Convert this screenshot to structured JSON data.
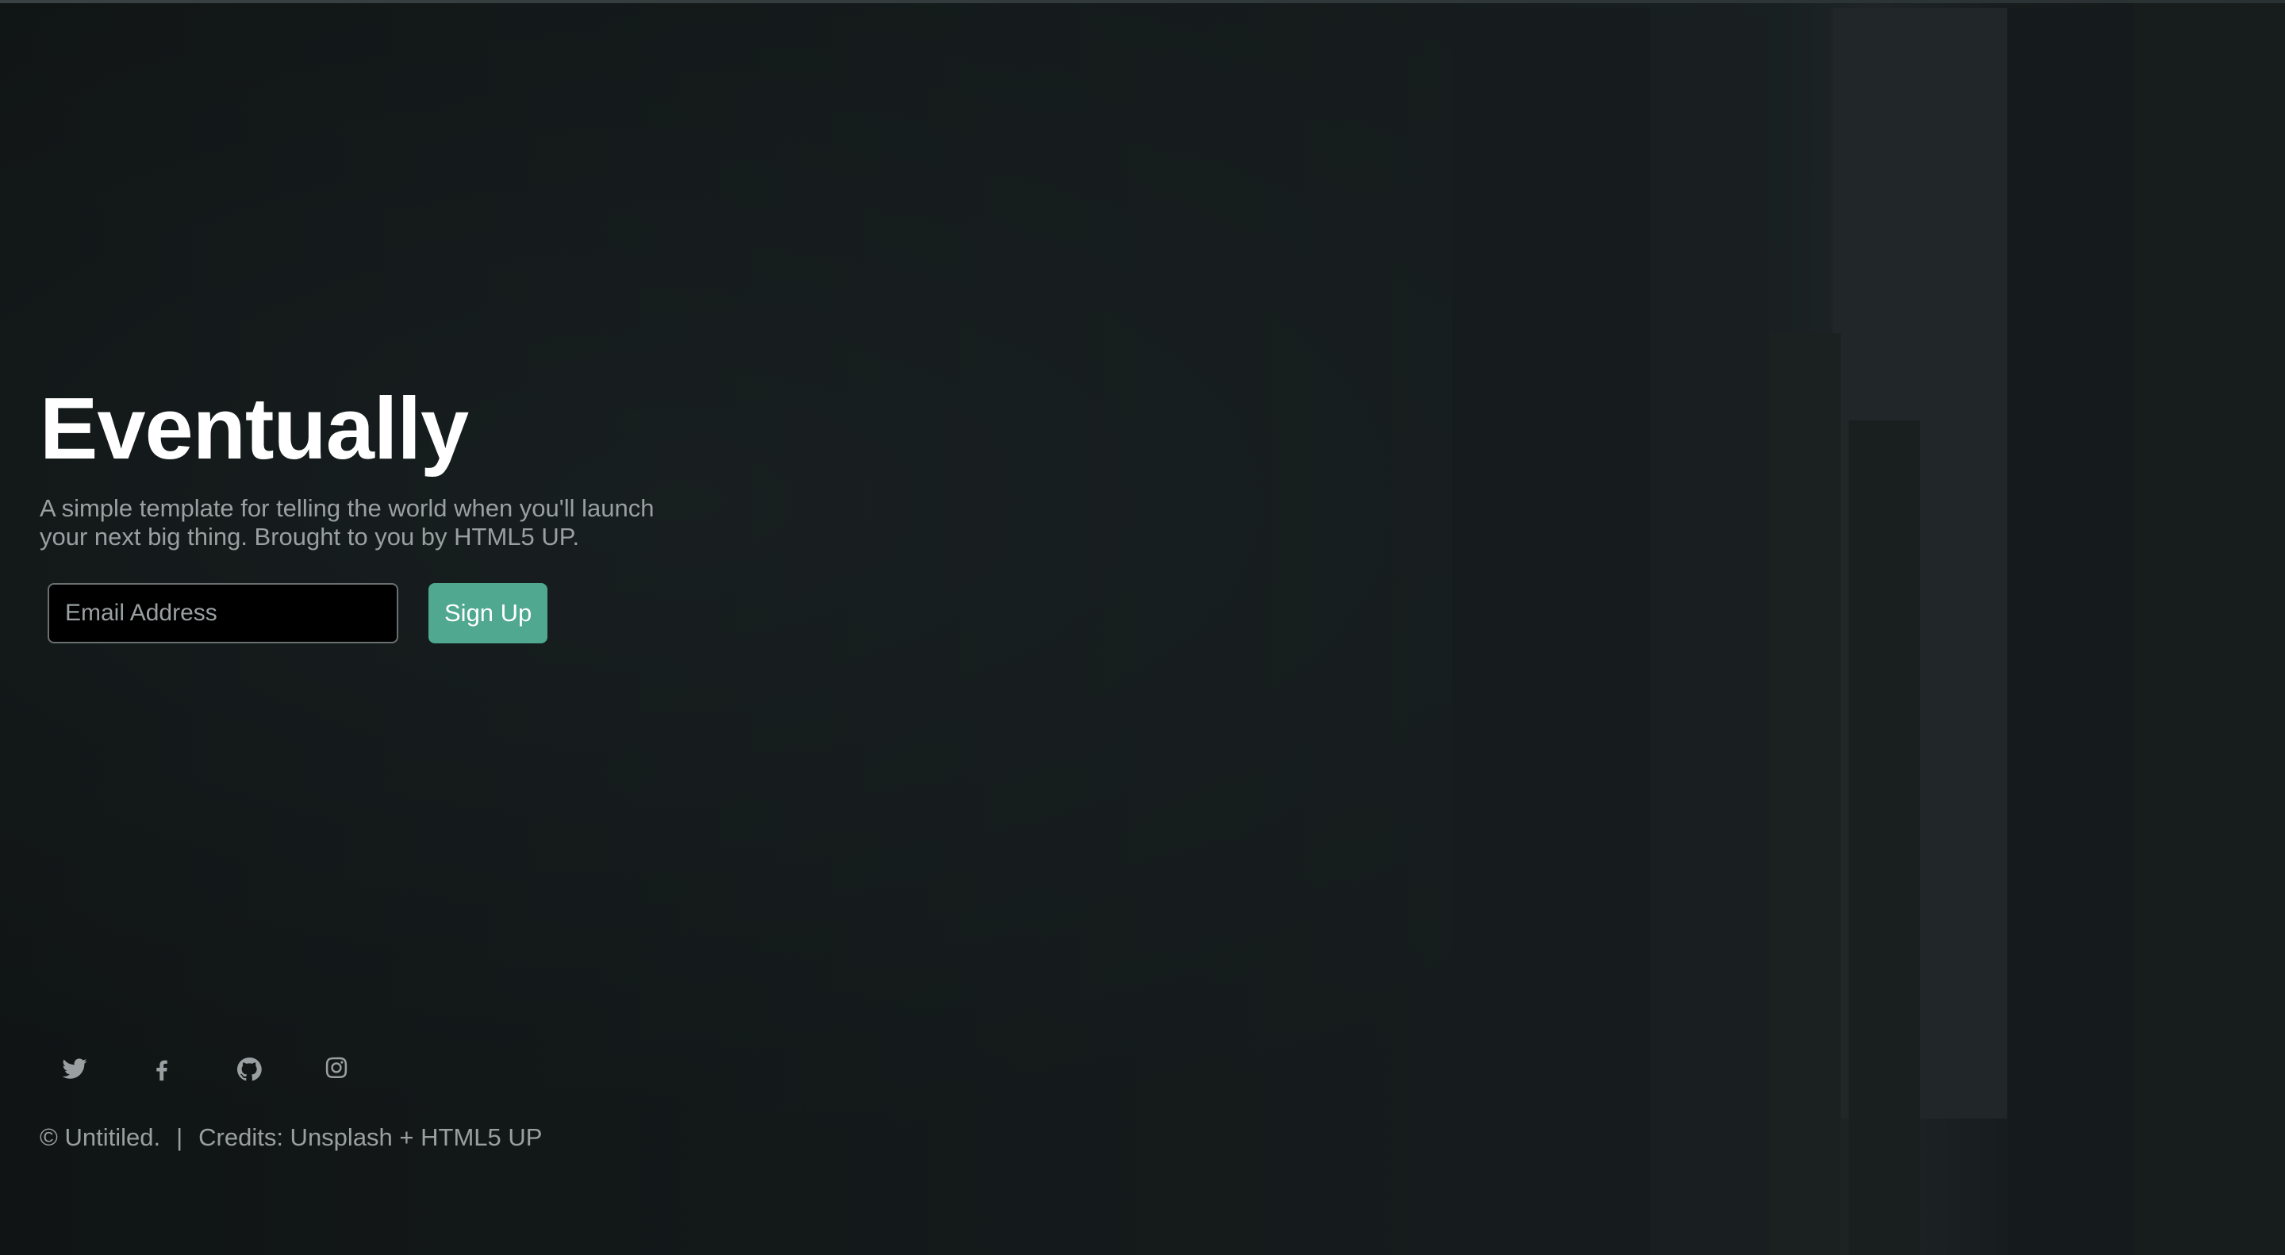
{
  "header": {
    "title": "Eventually",
    "subtitle": "A simple template for telling the world when you'll launch your next big thing. Brought to you by HTML5 UP."
  },
  "signup_form": {
    "email_placeholder": "Email Address",
    "email_value": "",
    "submit_label": "Sign Up"
  },
  "social": {
    "icons": [
      "twitter-icon",
      "facebook-icon",
      "github-icon",
      "instagram-icon"
    ]
  },
  "footer": {
    "copyright": "© Untitiled.",
    "separator": "|",
    "credits": "Credits: Unsplash + HTML5 UP"
  },
  "colors": {
    "accent": "#4fa88f",
    "text_muted": "#9aa0a2",
    "background": "#151a1b"
  }
}
